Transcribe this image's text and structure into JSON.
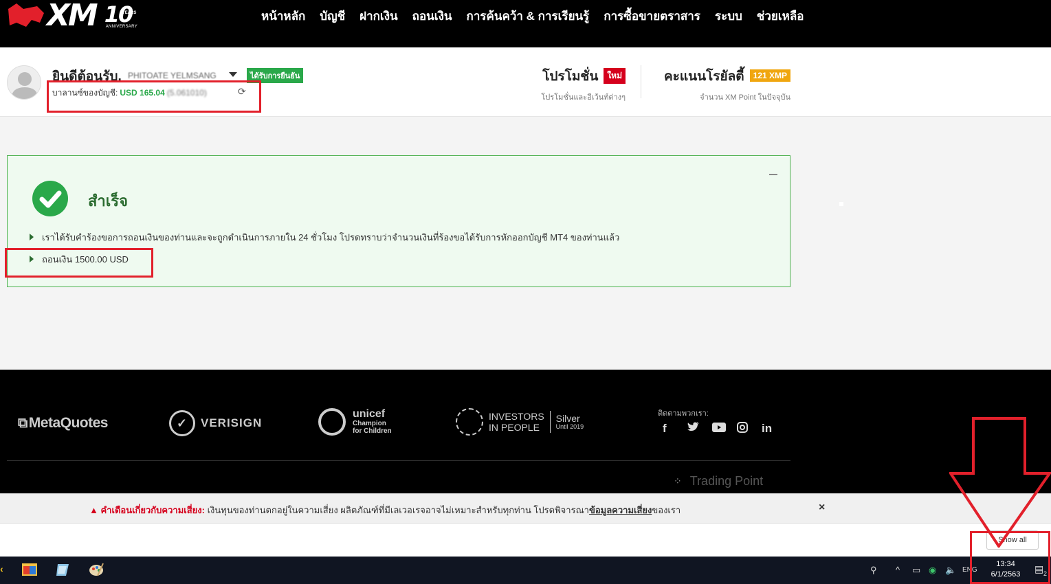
{
  "brand": {
    "logo_text": "XM",
    "anniversary_number": "10",
    "anniversary_years": "YEARS",
    "anniversary_label": "ANNIVERSARY"
  },
  "nav": {
    "items": [
      {
        "label": "หน้าหลัก"
      },
      {
        "label": "บัญชี"
      },
      {
        "label": "ฝากเงิน"
      },
      {
        "label": "ถอนเงิน"
      },
      {
        "label": "การค้นคว้า & การเรียนรู้"
      },
      {
        "label": "การซื้อขายตราสาร"
      },
      {
        "label": "ระบบ"
      },
      {
        "label": "ช่วยเหลือ"
      }
    ]
  },
  "account": {
    "welcome": "ยินดีต้อนรับ,",
    "name_redacted": "PHITOATE YELMSANG",
    "verified_badge": "ได้รับการยืนยัน",
    "balance_label": "บาลานซ์ของบัญชี:",
    "balance_amount": "USD 165.04",
    "account_number_redacted": "(5.061010)"
  },
  "promotions": {
    "title": "โปรโมชั่น",
    "badge": "ใหม่",
    "subtitle": "โปรโมชั่นและอีเว้นท์ต่างๆ"
  },
  "loyalty": {
    "title": "คะแนนโรยัลตี้",
    "badge": "121 XMP",
    "subtitle": "จำนวน XM Point ในปัจจุบัน"
  },
  "success": {
    "title": "สำเร็จ",
    "message": "เราได้รับคำร้องขอการถอนเงินของท่านและจะถูกดำเนินการภายใน 24 ชั่วโมง โปรดทราบว่าจำนวนเงินที่ร้องขอได้รับการหักออกบัญชี MT4 ของท่านแล้ว",
    "withdraw_line": "ถอนเงิน 1500.00 USD"
  },
  "footer": {
    "partners": {
      "metaquotes": "MetaQuotes",
      "verisign": "VERISIGN",
      "unicef": "unicef",
      "unicef_sub1": "Champion",
      "unicef_sub2": "for Children",
      "iip_line1": "INVESTORS",
      "iip_line2": "IN PEOPLE",
      "iip_silver": "Silver",
      "iip_until": "Until 2019"
    },
    "follow_label": "ติดตามพวกเรา:",
    "social": [
      "f",
      "t",
      "yt",
      "ig",
      "in"
    ],
    "trading_point": "Trading Point"
  },
  "risk": {
    "title": "คำเตือนเกี่ยวกับความเสี่ยง:",
    "text": " เงินทุนของท่านตกอยู่ในความเสี่ยง ผลิตภัณฑ์ที่มีเลเวอเรจอาจไม่เหมาะสำหรับทุกท่าน โปรดพิจารณา",
    "link": "ข้อมูลความเสี่ยง",
    "text_end": "ของเรา",
    "close": "×"
  },
  "downloads": {
    "show_all": "Show all"
  },
  "taskbar": {
    "language": "ENG",
    "time": "13:34",
    "date": "6/1/2563",
    "notification_count": "2"
  },
  "colors": {
    "nav_bg": "#000000",
    "brand_red": "#e2202b",
    "success_green": "#2aa84a",
    "loyalty_gold": "#f0a60f",
    "annotation_red": "#e2202b"
  }
}
